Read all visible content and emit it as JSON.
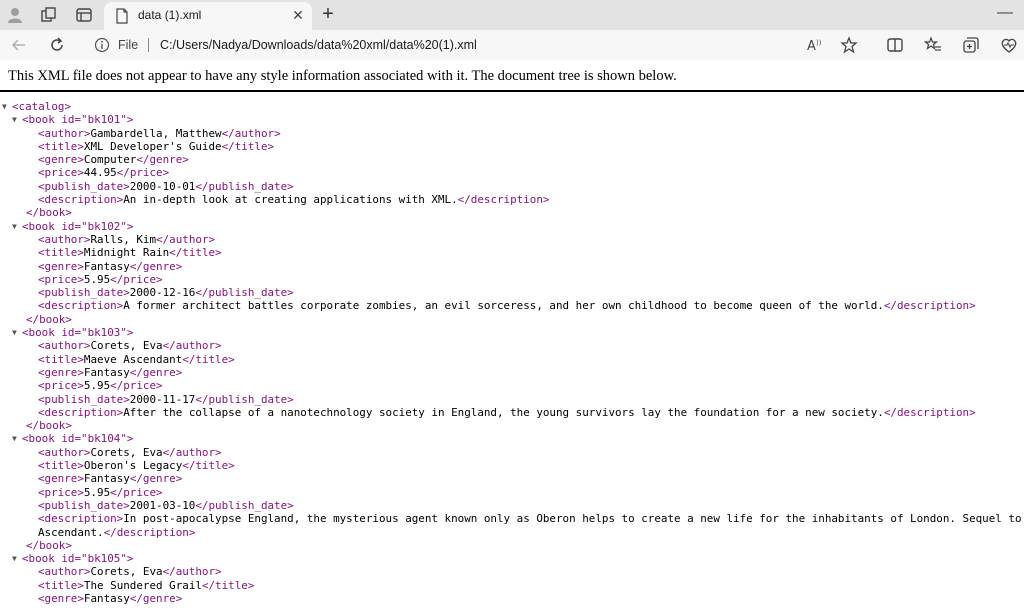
{
  "tab": {
    "title": "data (1).xml"
  },
  "address": {
    "scheme_label": "File",
    "url": "C:/Users/Nadya/Downloads/data%20xml/data%20(1).xml"
  },
  "notice": "This XML file does not appear to have any style information associated with it. The document tree is shown below.",
  "xml": {
    "root_open": "<catalog>",
    "book_close": "</book>",
    "books": [
      {
        "open": "<book id=\"bk101\">",
        "author": "Gambardella, Matthew",
        "title": "XML Developer's Guide",
        "genre": "Computer",
        "price": "44.95",
        "publish_date": "2000-10-01",
        "description": "An in-depth look at creating applications with XML."
      },
      {
        "open": "<book id=\"bk102\">",
        "author": "Ralls, Kim",
        "title": "Midnight Rain",
        "genre": "Fantasy",
        "price": "5.95",
        "publish_date": "2000-12-16",
        "description": "A former architect battles corporate zombies, an evil sorceress, and her own childhood to become queen of the world."
      },
      {
        "open": "<book id=\"bk103\">",
        "author": "Corets, Eva",
        "title": "Maeve Ascendant",
        "genre": "Fantasy",
        "price": "5.95",
        "publish_date": "2000-11-17",
        "description": "After the collapse of a nanotechnology society in England, the young survivors lay the foundation for a new society."
      },
      {
        "open": "<book id=\"bk104\">",
        "author": "Corets, Eva",
        "title": "Oberon's Legacy",
        "genre": "Fantasy",
        "price": "5.95",
        "publish_date": "2001-03-10",
        "description_line1": "In post-apocalypse England, the mysterious agent known only as Oberon helps to create a new life for the inhabitants of London. Sequel to Maeve",
        "description_line2": "Ascendant."
      },
      {
        "open": "<book id=\"bk105\">",
        "author": "Corets, Eva",
        "title": "The Sundered Grail",
        "genre": "Fantasy"
      }
    ]
  },
  "icons": {
    "profile": "profile-icon",
    "workspaces": "workspaces-icon",
    "tab_actions": "tab-actions-icon",
    "file": "file-icon",
    "close": "close-icon",
    "new_tab": "plus-icon",
    "minimize": "minimize-icon",
    "back": "back-arrow-icon",
    "refresh": "refresh-icon",
    "info": "info-icon",
    "read_aloud": "read-aloud-icon",
    "favorite": "star-icon",
    "split": "split-screen-icon",
    "favorites": "favorites-icon",
    "collections": "collections-icon",
    "health": "browser-essentials-icon"
  }
}
